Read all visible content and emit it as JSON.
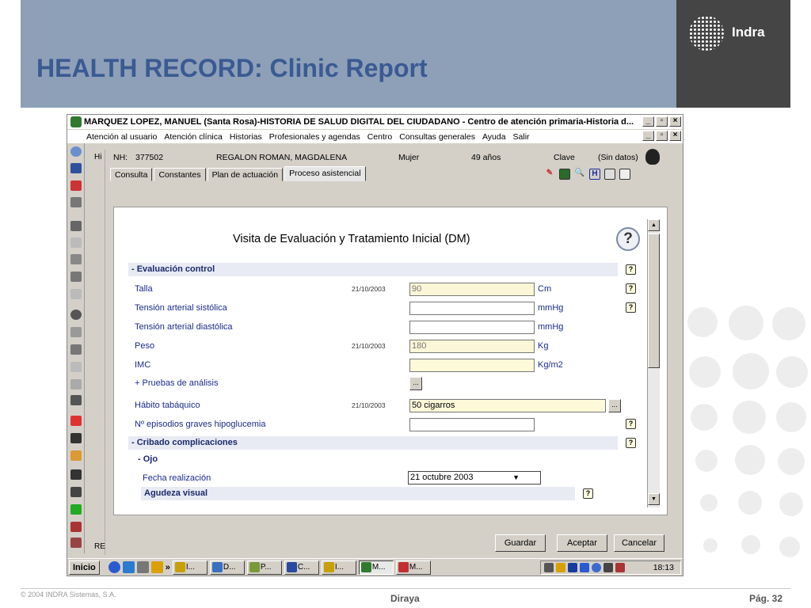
{
  "slide": {
    "title": "HEALTH RECORD: Clinic Report",
    "logo_text": "Indra",
    "footer_copyright": "© 2004 INDRA Sistemas, S.A.",
    "footer_center": "Diraya",
    "footer_page": "Pág. 32"
  },
  "window": {
    "title": "MARQUEZ LOPEZ, MANUEL (Santa Rosa)-HISTORIA DE SALUD DIGITAL  DEL CIUDADANO - Centro de atención primaria-Historia d...",
    "buttons": [
      "_",
      "▫",
      "×"
    ],
    "menu": [
      "Atención al usuario",
      "Atención clínica",
      "Historias",
      "Profesionales y agendas",
      "Centro",
      "Consultas generales",
      "Ayuda",
      "Salir"
    ]
  },
  "patient": {
    "nh_label": "NH:",
    "nh": "377502",
    "name": "REGALON ROMAN, MAGDALENA",
    "sex": "Mujer",
    "age": "49 años",
    "key_label": "Clave",
    "key_value": "(Sin datos)"
  },
  "tabs": [
    "Consulta",
    "Constantes",
    "Plan de actuación",
    "Proceso asistencial"
  ],
  "side_labels": {
    "hi": "Hi",
    "re": "RE"
  },
  "form": {
    "title": "Visita de Evaluación y Tratamiento Inicial (DM)",
    "help": "?",
    "section1": "- Evaluación control",
    "rows": [
      {
        "label": "Talla",
        "date": "21/10/2003",
        "value": "90",
        "unit": "Cm"
      },
      {
        "label": "Tensión arterial sistólica",
        "date": "",
        "value": "",
        "unit": "mmHg"
      },
      {
        "label": "Tensión arterial diastólica",
        "date": "",
        "value": "",
        "unit": "mmHg"
      },
      {
        "label": "Peso",
        "date": "21/10/2003",
        "value": "180",
        "unit": "Kg"
      },
      {
        "label": "IMC",
        "date": "",
        "value": "",
        "unit": "Kg/m2"
      }
    ],
    "pruebas": "+ Pruebas de análisis",
    "habito_label": "Hábito tabáquico",
    "habito_date": "21/10/2003",
    "habito_value": "50 cigarros",
    "episodios_label": "Nº episodios graves hipoglucemia",
    "dots": "...",
    "section2": "- Cribado complicaciones",
    "sub_ojo": "- Ojo",
    "fecha_label": "Fecha realización",
    "fecha_value": "21 octubre 2003",
    "agudeza": "Agudeza visual"
  },
  "actions": {
    "guardar": "Guardar",
    "aceptar": "Aceptar",
    "cancelar": "Cancelar"
  },
  "taskbar": {
    "start": "Inicio",
    "more": "»",
    "tasks": [
      "I...",
      "D...",
      "P...",
      "C...",
      "I...",
      "M...",
      "M..."
    ],
    "clock": "18:13"
  }
}
